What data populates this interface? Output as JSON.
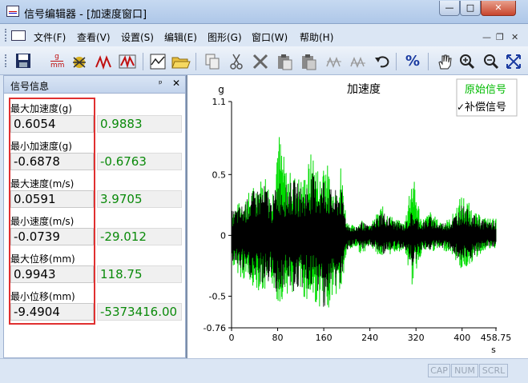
{
  "window": {
    "title": "信号编辑器 - [加速度窗口]",
    "min_glyph": "—",
    "max_glyph": "□",
    "close_glyph": "✕"
  },
  "menu": {
    "items": [
      "文件(F)",
      "查看(V)",
      "设置(S)",
      "编辑(E)",
      "图形(G)",
      "窗口(W)",
      "帮助(H)"
    ],
    "mdi_min": "—",
    "mdi_restore": "❐",
    "mdi_close": "✕"
  },
  "toolbar": {
    "icons": [
      "save-icon",
      "unit-gmm-icon",
      "signal-bug-icon",
      "peak-icon",
      "peak-window-icon",
      "chart-icon",
      "open-folder-icon",
      "copy-icon",
      "cut-icon",
      "delete-icon",
      "paste-icon",
      "paste-special-icon",
      "scale-icon",
      "scale-alt-icon",
      "undo-icon",
      "percent-icon",
      "pan-hand-icon",
      "zoom-in-icon",
      "zoom-out-icon",
      "fit-icon"
    ],
    "unit_top": "g",
    "unit_bottom": "mm",
    "percent": "%"
  },
  "panel": {
    "title": "信号信息",
    "pin": "ᵖ",
    "close": "✕",
    "rows": [
      {
        "label": "最大加速度(g)",
        "value": "0.6054",
        "compensated": "0.9883"
      },
      {
        "label": "最小加速度(g)",
        "value": "-0.6878",
        "compensated": "-0.6763"
      },
      {
        "label": "最大速度(m/s)",
        "value": "0.0591",
        "compensated": "3.9705"
      },
      {
        "label": "最小速度(m/s)",
        "value": "-0.0739",
        "compensated": "-29.012"
      },
      {
        "label": "最大位移(mm)",
        "value": "0.9943",
        "compensated": "118.75"
      },
      {
        "label": "最小位移(mm)",
        "value": "-9.4904",
        "compensated": "-5373416.00"
      }
    ]
  },
  "colors": {
    "original": "#00dd00",
    "compensated": "#000000",
    "highlight": "#e03030",
    "value_green": "#0a8a0a"
  },
  "chart_data": {
    "type": "line",
    "title": "加速度",
    "ylabel": "g",
    "xlabel": "s",
    "ylim": [
      -0.76,
      1.1
    ],
    "xlim": [
      0,
      458.75
    ],
    "x_ticks": [
      0,
      80,
      160,
      240,
      320,
      400,
      458.75
    ],
    "x_tick_labels": [
      "0",
      "80",
      "160",
      "240",
      "320",
      "400",
      "458.75"
    ],
    "y_ticks": [
      1.1,
      0.5,
      0,
      -0.5,
      -0.76
    ],
    "y_tick_labels": [
      "1.1",
      "0.5",
      "0",
      "-0.5",
      "-0.76"
    ],
    "legend": {
      "placement": "top-right",
      "items": [
        {
          "name": "原始信号",
          "color": "#00dd00",
          "checked": false
        },
        {
          "name": "补偿信号",
          "color": "#000000",
          "checked": true
        }
      ]
    },
    "check_glyph": "✓",
    "series": [
      {
        "name": "原始信号",
        "color": "#00dd00",
        "x": [
          0,
          20,
          40,
          60,
          70,
          80,
          95,
          110,
          125,
          140,
          155,
          160,
          175,
          190,
          200,
          215,
          225,
          240,
          260,
          280,
          300,
          313,
          330,
          345,
          360,
          380,
          400,
          425,
          440,
          458.75
        ],
        "max": [
          0.22,
          0.3,
          0.42,
          0.52,
          0.3,
          0.93,
          0.55,
          0.5,
          0.48,
          0.72,
          0.48,
          0.75,
          0.38,
          0.6,
          0.12,
          0.07,
          0.14,
          0.08,
          0.25,
          0.15,
          0.1,
          0.55,
          0.13,
          0.2,
          0.12,
          0.14,
          0.35,
          0.18,
          0.15,
          0.14
        ],
        "min": [
          -0.25,
          -0.37,
          -0.43,
          -0.5,
          -0.4,
          -0.58,
          -0.48,
          -0.5,
          -0.52,
          -0.56,
          -0.6,
          -0.72,
          -0.5,
          -0.5,
          -0.14,
          -0.1,
          -0.16,
          -0.09,
          -0.19,
          -0.15,
          -0.12,
          -0.42,
          -0.14,
          -0.14,
          -0.12,
          -0.14,
          -0.3,
          -0.19,
          -0.12,
          -0.12
        ]
      },
      {
        "name": "补偿信号",
        "color": "#000000",
        "x": [
          0,
          20,
          40,
          60,
          70,
          80,
          95,
          110,
          125,
          140,
          155,
          160,
          175,
          190,
          200,
          215,
          225,
          240,
          260,
          280,
          300,
          313,
          330,
          345,
          360,
          380,
          400,
          425,
          440,
          458.75
        ],
        "max": [
          0.2,
          0.26,
          0.38,
          0.42,
          0.27,
          0.48,
          0.42,
          0.46,
          0.38,
          0.52,
          0.42,
          0.5,
          0.36,
          0.4,
          0.1,
          0.06,
          0.12,
          0.07,
          0.21,
          0.13,
          0.09,
          0.2,
          0.11,
          0.16,
          0.1,
          0.12,
          0.26,
          0.15,
          0.13,
          0.12
        ],
        "min": [
          -0.22,
          -0.32,
          -0.38,
          -0.42,
          -0.36,
          -0.5,
          -0.42,
          -0.48,
          -0.44,
          -0.46,
          -0.5,
          -0.6,
          -0.44,
          -0.42,
          -0.12,
          -0.08,
          -0.14,
          -0.08,
          -0.16,
          -0.13,
          -0.1,
          -0.25,
          -0.12,
          -0.12,
          -0.1,
          -0.12,
          -0.25,
          -0.17,
          -0.1,
          -0.1
        ]
      }
    ]
  },
  "status": {
    "panes": [
      "CAP",
      "NUM",
      "SCRL"
    ]
  }
}
